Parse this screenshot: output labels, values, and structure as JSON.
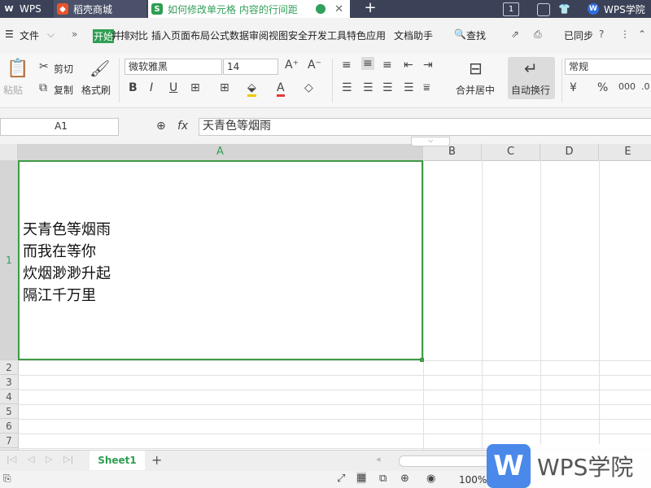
{
  "titlebar": {
    "tabs": [
      {
        "label": "WPS"
      },
      {
        "label": "稻壳商城"
      },
      {
        "label": "如何修改单元格 内容的行间距"
      }
    ],
    "window_count": "1",
    "academy": "WPS学院"
  },
  "menu": {
    "file": "文件",
    "items": [
      "开始",
      "插入",
      "页面布局",
      "公式",
      "数据",
      "审阅",
      "视图",
      "安全",
      "开发工具",
      "特色应用",
      "文档助手"
    ],
    "overlap_text": "并排对比",
    "search": "查找",
    "sync": "已同步"
  },
  "ribbon": {
    "paste": "粘贴",
    "cut": "剪切",
    "copy": "复制",
    "format_painter": "格式刷",
    "font_name": "微软雅黑",
    "font_size": "14",
    "merge_center": "合并居中",
    "wrap_text": "自动换行",
    "number_format": "常规"
  },
  "formula_bar": {
    "name_box": "A1",
    "fx": "fx",
    "content": "天青色等烟雨"
  },
  "columns": [
    "A",
    "B",
    "C",
    "D",
    "E"
  ],
  "rows": [
    "1",
    "2",
    "3",
    "4",
    "5",
    "6",
    "7"
  ],
  "cell_a1": {
    "lines": [
      "天青色等烟雨",
      "而我在等你",
      "炊烟渺渺升起",
      "隔江千万里"
    ]
  },
  "sheets": {
    "active": "Sheet1",
    "add": "+"
  },
  "status": {
    "zoom": "100%"
  },
  "watermark": {
    "text": "WPS学院"
  },
  "colors": {
    "accent": "#2f9e52",
    "titlebar": "#3b4257",
    "selection": "#3f9a45"
  }
}
